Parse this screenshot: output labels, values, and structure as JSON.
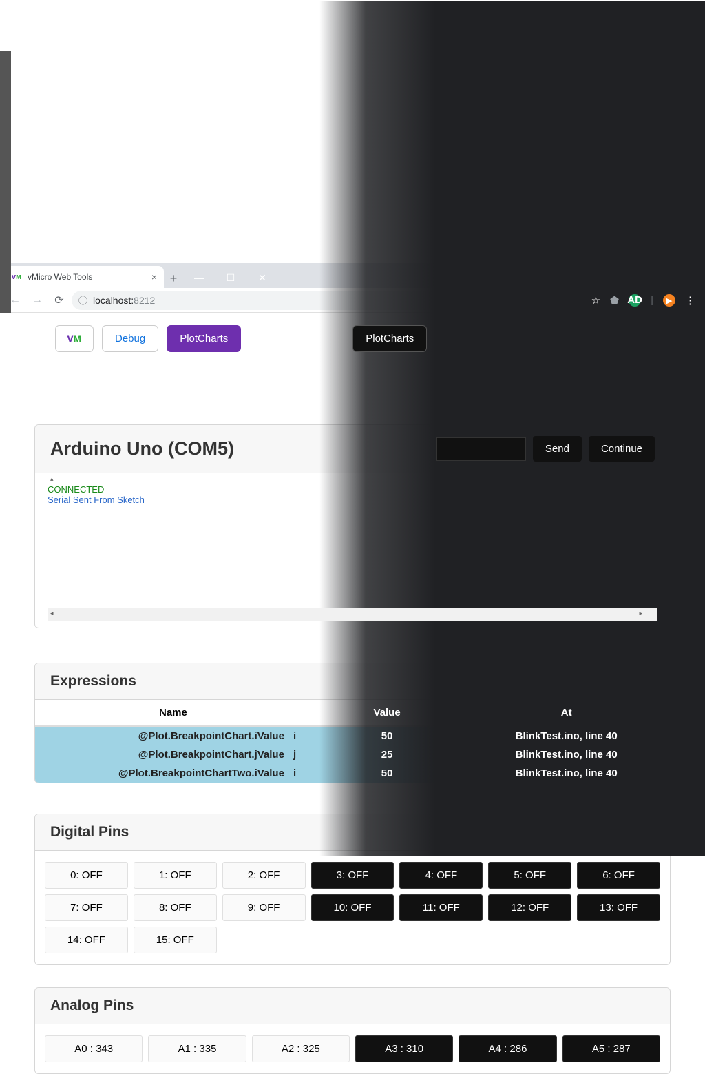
{
  "browser": {
    "tab_title": "vMicro Web Tools",
    "url_host": "localhost:",
    "url_port": "8212"
  },
  "topbar": {
    "debug_label": "Debug",
    "plot_label": "PlotCharts",
    "plot2_label": "PlotCharts"
  },
  "arduino": {
    "title": "Arduino Uno (COM5)",
    "send_label": "Send",
    "continue_label": "Continue",
    "connected": "CONNECTED",
    "serial": "Serial Sent From Sketch"
  },
  "expressions": {
    "title": "Expressions",
    "headers": {
      "name": "Name",
      "value": "Value",
      "at": "At"
    },
    "rows": [
      {
        "name": "@Plot.BreakpointChart.iValue",
        "var": "i",
        "value": "50",
        "at": "BlinkTest.ino, line 40"
      },
      {
        "name": "@Plot.BreakpointChart.jValue",
        "var": "j",
        "value": "25",
        "at": "BlinkTest.ino, line 40"
      },
      {
        "name": "@Plot.BreakpointChartTwo.iValue",
        "var": "i",
        "value": "50",
        "at": "BlinkTest.ino, line 40"
      }
    ]
  },
  "digital": {
    "title": "Digital Pins",
    "pins": [
      "0: OFF",
      "1: OFF",
      "2: OFF",
      "3: OFF",
      "4: OFF",
      "5: OFF",
      "6: OFF",
      "7: OFF",
      "8: OFF",
      "9: OFF",
      "10: OFF",
      "11: OFF",
      "12: OFF",
      "13: OFF",
      "14: OFF",
      "15: OFF"
    ]
  },
  "analog": {
    "title": "Analog Pins",
    "pins": [
      "A0 : 343",
      "A1 : 335",
      "A2 : 325",
      "A3 : 310",
      "A4 : 286",
      "A5 : 287"
    ]
  }
}
